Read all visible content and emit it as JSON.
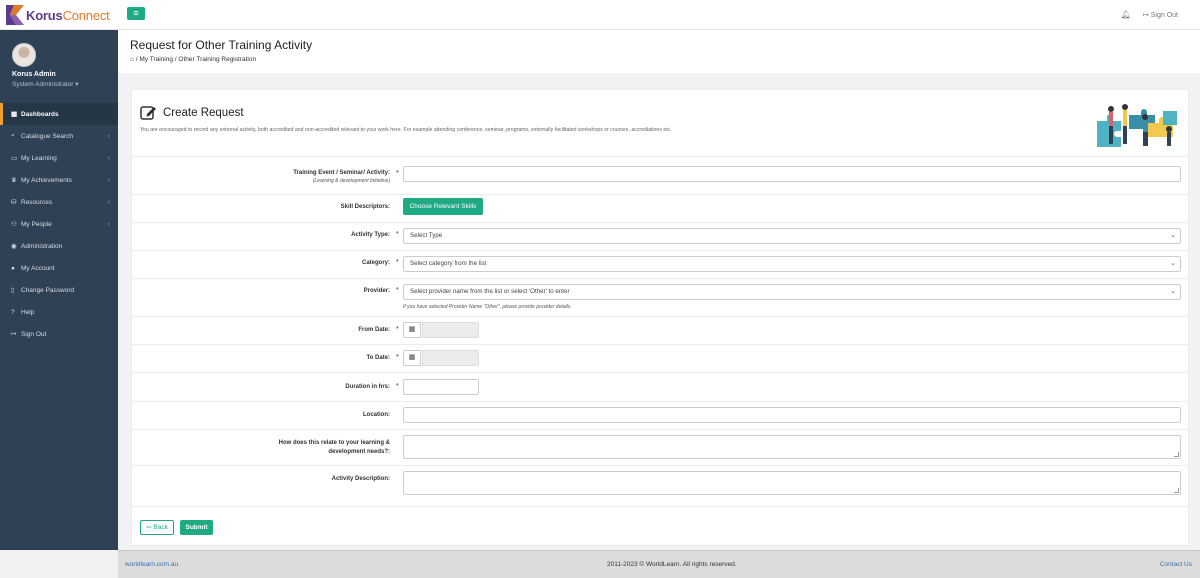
{
  "app": {
    "logo_part1": "Korus",
    "logo_part2": "Connect",
    "menu_icon": "hamburger-icon"
  },
  "topbar": {
    "bell_icon": "bell-icon",
    "sign_out_label": "Sign Out"
  },
  "profile": {
    "name": "Korus Admin",
    "role": "System Administrator"
  },
  "sidebar": {
    "items": [
      {
        "label": "Dashboards",
        "icon": "dashboard-icon",
        "active": true,
        "chevron": false
      },
      {
        "label": "Catalogue Search",
        "icon": "search-icon",
        "active": false,
        "chevron": true
      },
      {
        "label": "My Learning",
        "icon": "monitor-icon",
        "active": false,
        "chevron": true
      },
      {
        "label": "My Achievements",
        "icon": "trophy-icon",
        "active": false,
        "chevron": true
      },
      {
        "label": "Resources",
        "icon": "resources-icon",
        "active": false,
        "chevron": true
      },
      {
        "label": "My People",
        "icon": "people-icon",
        "active": false,
        "chevron": true
      },
      {
        "label": "Administration",
        "icon": "admin-icon",
        "active": false,
        "chevron": false
      },
      {
        "label": "My Account",
        "icon": "user-icon",
        "active": false,
        "chevron": false
      },
      {
        "label": "Change Password",
        "icon": "lock-icon",
        "active": false,
        "chevron": false
      },
      {
        "label": "Help",
        "icon": "help-icon",
        "active": false,
        "chevron": false
      },
      {
        "label": "Sign Out",
        "icon": "sign-out-icon",
        "active": false,
        "chevron": false
      }
    ]
  },
  "header": {
    "title": "Request for Other Training Activity",
    "breadcrumb": [
      "My Training",
      "Other Training Registration"
    ]
  },
  "form": {
    "title": "Create Request",
    "intro": "You are encouraged to record any external activity, both accredited and non-accredited relevant to your work here. For example attending conference, seminar, programs, externally facilitated workshops or courses, accrediations etc.",
    "training_event_label": "Training Event / Seminar/ Activity:",
    "training_event_sub": "(Learning & development Initiative)",
    "skill_descriptors_label": "Skill Descriptors:",
    "choose_skills_button": "Choose Relevant Skills",
    "activity_type_label": "Activity Type:",
    "activity_type_value": "Select Type",
    "category_label": "Category:",
    "category_value": "Select category from the list",
    "provider_label": "Provider:",
    "provider_value": "Select provider name from the list or select 'Other' to enter",
    "provider_hint": "If you have selected Provider Name \"Other\", please provide provider details.",
    "from_date_label": "From Date:",
    "to_date_label": "To Date:",
    "duration_label": "Duration in hrs:",
    "location_label": "Location:",
    "relate_label": "How does this relate to your learning & development needs?:",
    "description_label": "Activity Description:",
    "required_mark": "*",
    "back_button": "Back",
    "submit_button": "Submit"
  },
  "footer": {
    "left": "worldlearn.com.au",
    "center": "2011-2023 © WorldLearn. All rights reserved.",
    "right": "Contact Us"
  },
  "colors": {
    "accent": "#1eaa82",
    "sidebar": "#2e4155",
    "active_marker": "#f0a030"
  }
}
